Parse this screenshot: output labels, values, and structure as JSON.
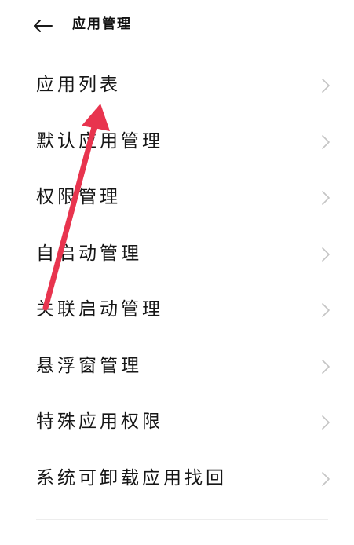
{
  "header": {
    "back_icon": "arrow-left-icon",
    "title": "应用管理"
  },
  "menu": {
    "items": [
      {
        "label": "应用列表"
      },
      {
        "label": "默认应用管理"
      },
      {
        "label": "权限管理"
      },
      {
        "label": "自启动管理"
      },
      {
        "label": "关联启动管理"
      },
      {
        "label": "悬浮窗管理"
      },
      {
        "label": "特殊应用权限"
      },
      {
        "label": "系统可卸载应用找回"
      }
    ],
    "chevron_icon": "chevron-right-icon"
  },
  "colors": {
    "background": "#ffffff",
    "text": "#161616",
    "chevron": "#c4c4c4",
    "annotation_arrow": "#e8344e"
  }
}
